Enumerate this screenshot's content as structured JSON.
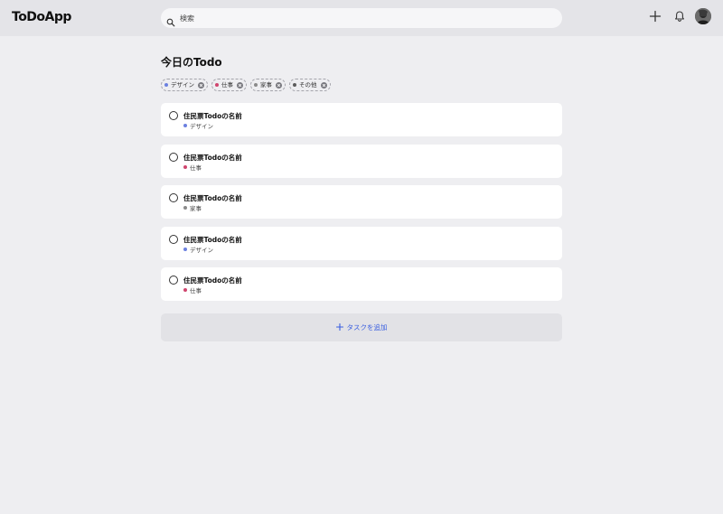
{
  "header": {
    "logo": "ToDoApp",
    "search_placeholder": "検索"
  },
  "main": {
    "title": "今日のTodo",
    "filters": [
      {
        "label": "デザイン",
        "color": "#6b80e0"
      },
      {
        "label": "仕事",
        "color": "#d0456e"
      },
      {
        "label": "家事",
        "color": "#8a8a8a"
      },
      {
        "label": "その他",
        "color": "#5c5c5c"
      }
    ],
    "todos": [
      {
        "name": "住民票Todoの名前",
        "category": "デザイン",
        "color": "#6b80e0"
      },
      {
        "name": "住民票Todoの名前",
        "category": "仕事",
        "color": "#d0456e"
      },
      {
        "name": "住民票Todoの名前",
        "category": "家事",
        "color": "#8a8a8a"
      },
      {
        "name": "住民票Todoの名前",
        "category": "デザイン",
        "color": "#6b80e0"
      },
      {
        "name": "住民票Todoの名前",
        "category": "仕事",
        "color": "#d0456e"
      }
    ],
    "add_task_label": "タスクを追加"
  },
  "colors": {
    "accent": "#3a5fe0",
    "background": "#eeeef1",
    "header_bg": "#e4e4e8"
  },
  "icons": [
    "search-icon",
    "plus-icon",
    "bell-icon",
    "avatar",
    "close-icon",
    "radio-circle-icon"
  ]
}
